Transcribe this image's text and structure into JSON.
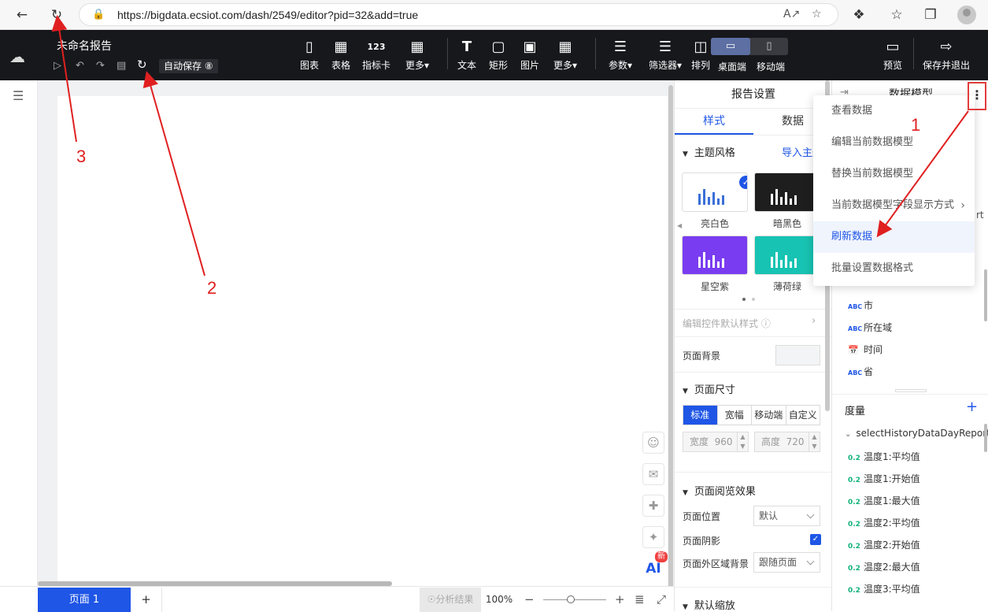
{
  "browser": {
    "url": "https://bigdata.ecsiot.com/dash/2549/editor?pid=32&add=true"
  },
  "header": {
    "report_title": "未命名报告",
    "autosave_label": "自动保存 ⑧",
    "toolbar": [
      {
        "label": "图表",
        "icon": "bar-chart-icon"
      },
      {
        "label": "表格",
        "icon": "table-icon"
      },
      {
        "label": "指标卡",
        "icon": "metric-card-icon"
      },
      {
        "label": "更多▾",
        "icon": "grid-icon"
      },
      {
        "label": "文本",
        "icon": "text-icon"
      },
      {
        "label": "矩形",
        "icon": "rectangle-icon"
      },
      {
        "label": "图片",
        "icon": "image-icon"
      },
      {
        "label": "更多▾",
        "icon": "grid-icon"
      },
      {
        "label": "参数▾",
        "icon": "sliders-icon"
      },
      {
        "label": "筛选器▾",
        "icon": "filter-list-icon"
      },
      {
        "label": "排列▾",
        "icon": "arrange-icon"
      }
    ],
    "device_desktop": "桌面端",
    "device_mobile": "移动端",
    "preview": "预览",
    "save_exit": "保存并退出"
  },
  "canvas": {
    "page_tab": "页面 1",
    "add_page": "+",
    "analyze": "分析结果",
    "zoom": "100%",
    "ai_label": "AI",
    "ai_badge": "新"
  },
  "settings": {
    "title": "报告设置",
    "tabs": [
      "样式",
      "数据"
    ],
    "theme_section": "主题风格",
    "import_theme": "导入主题",
    "themes": [
      {
        "label": "亮白色",
        "bg": "#ffffff",
        "bar": "#3a6fd8",
        "selected": true
      },
      {
        "label": "暗黑色",
        "bg": "#1e1e1e",
        "bar": "#ffffff",
        "selected": false
      },
      {
        "label": "星空紫",
        "bg": "#7a3cf0",
        "bar": "#ffffff",
        "selected": false
      },
      {
        "label": "薄荷绿",
        "bg": "#17c3b2",
        "bar": "#ffffff",
        "selected": false
      }
    ],
    "edit_default_style": "编辑控件默认样式",
    "page_bg": "页面背景",
    "page_size_section": "页面尺寸",
    "size_options": [
      "标准",
      "宽幅",
      "移动端",
      "自定义"
    ],
    "width_label": "宽度",
    "width_value": "960",
    "height_label": "高度",
    "height_value": "720",
    "browse_section": "页面阅览效果",
    "page_position_label": "页面位置",
    "page_position_value": "默认",
    "page_shadow_label": "页面阴影",
    "outer_bg_label": "页面外区域背景",
    "outer_bg_value": "跟随页面",
    "default_zoom_section": "默认缩放"
  },
  "model": {
    "title": "数据模型",
    "partial_text": "rt",
    "dimensions": [
      {
        "type": "ABC",
        "name": "市"
      },
      {
        "type": "ABC",
        "name": "所在域"
      },
      {
        "type": "time",
        "name": "时间"
      },
      {
        "type": "ABC",
        "name": "省"
      }
    ],
    "measure_label": "度量",
    "dataset": "selectHistoryDataDayReport",
    "measures": [
      {
        "type": "0.2",
        "name": "温度1:平均值"
      },
      {
        "type": "0.2",
        "name": "温度1:开始值"
      },
      {
        "type": "0.2",
        "name": "温度1:最大值"
      },
      {
        "type": "0.2",
        "name": "温度2:平均值"
      },
      {
        "type": "0.2",
        "name": "温度2:开始值"
      },
      {
        "type": "0.2",
        "name": "温度2:最大值"
      },
      {
        "type": "0.2",
        "name": "温度3:平均值"
      }
    ]
  },
  "menu": {
    "items": [
      {
        "label": "查看数据",
        "highlight": false
      },
      {
        "label": "编辑当前数据模型",
        "highlight": false
      },
      {
        "label": "替换当前数据模型",
        "highlight": false
      },
      {
        "label": "当前数据模型字段显示方式",
        "highlight": false,
        "submenu": true
      },
      {
        "label": "刷新数据",
        "highlight": true
      },
      {
        "label": "批量设置数据格式",
        "highlight": false
      }
    ]
  },
  "annotations": {
    "labels": [
      "1",
      "2",
      "3"
    ],
    "color": "#e02020"
  }
}
